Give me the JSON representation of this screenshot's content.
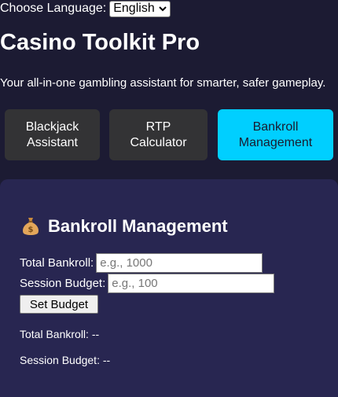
{
  "language": {
    "label": "Choose Language:",
    "selected": "English"
  },
  "header": {
    "title": "Casino Toolkit Pro",
    "tagline": "Your all-in-one gambling assistant for smarter, safer gameplay."
  },
  "tools": [
    {
      "line1": "Blackjack",
      "line2": "Assistant",
      "active": false
    },
    {
      "line1": "RTP",
      "line2": "Calculator",
      "active": false
    },
    {
      "line1": "Bankroll",
      "line2": "Management",
      "active": true
    }
  ],
  "panel": {
    "icon": "money-bag-icon",
    "title": "Bankroll Management",
    "fields": {
      "total_label": "Total Bankroll:",
      "total_placeholder": "e.g., 1000",
      "session_label": "Session Budget:",
      "session_placeholder": "e.g., 100"
    },
    "set_button": "Set Budget",
    "readouts": {
      "total": "Total Bankroll: --",
      "session": "Session Budget: --"
    }
  },
  "colors": {
    "background": "#1c1b33",
    "panel": "#282651",
    "active_accent": "#00cfff",
    "inactive_button": "#333335"
  }
}
